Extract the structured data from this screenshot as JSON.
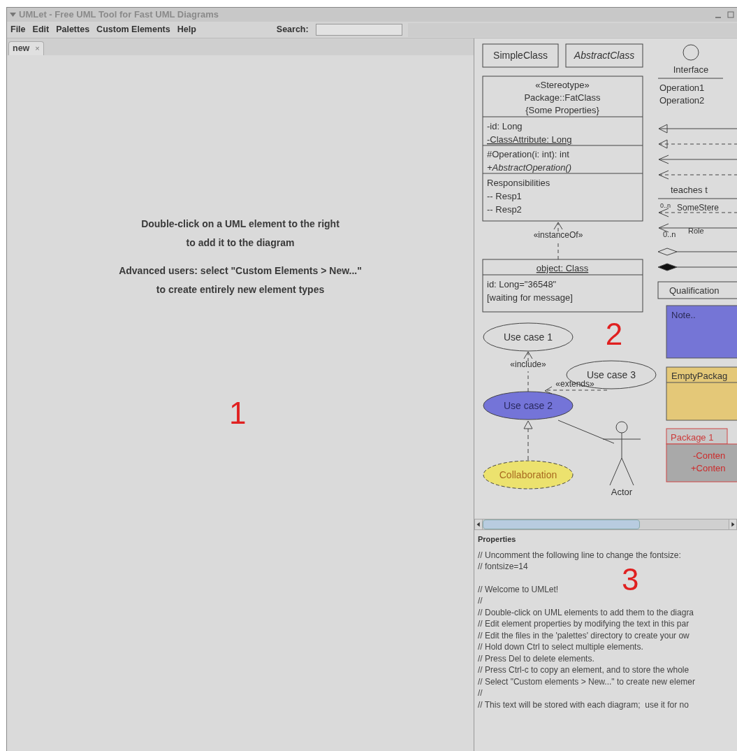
{
  "window": {
    "title": "UMLet - Free UML Tool for Fast UML Diagrams"
  },
  "menu": [
    {
      "label": "File"
    },
    {
      "label": "Edit"
    },
    {
      "label": "Palettes"
    },
    {
      "label": "Custom Elements"
    },
    {
      "label": "Help"
    }
  ],
  "search": {
    "label": "Search:"
  },
  "tabs": [
    {
      "label": "new",
      "selected": true,
      "close": "×"
    }
  ],
  "diagram": {
    "hints": [
      [
        "Double-click on a UML element to the right",
        "to add it to the diagram"
      ],
      [
        "Advanced users: select \"Custom Elements > New...\"",
        "to create entirely new element types"
      ]
    ],
    "annotation": "1"
  },
  "palette": {
    "annotation": "2",
    "simple_class": "SimpleClass",
    "abstract_class": "AbstractClass",
    "interface": {
      "name": "Interface",
      "operations": [
        "Operation1",
        "Operation2"
      ]
    },
    "fat_class": {
      "header": [
        "«Stereotype»",
        "Package::FatClass",
        "{Some Properties}"
      ],
      "attributes": [
        {
          "text": "-id: Long",
          "static": false
        },
        {
          "text": "-ClassAttribute: Long",
          "static": true
        }
      ],
      "operations": [
        {
          "text": "#Operation(i: int): int",
          "abstract": false
        },
        {
          "text": "+AbstractOperation()",
          "abstract": true
        }
      ],
      "responsibilities": [
        "Responsibilities",
        "-- Resp1",
        "-- Resp2"
      ]
    },
    "instance_of": "«instanceOf»",
    "object": {
      "title": "object: Class",
      "lines": [
        "id: Long=\"36548\"",
        "[waiting for message]"
      ]
    },
    "use_cases": [
      {
        "label": "Use case 1",
        "kind": "plain"
      },
      {
        "label": "Use case 3",
        "kind": "plain"
      },
      {
        "label": "Use case 2",
        "kind": "filled"
      },
      {
        "label": "Collaboration",
        "kind": "collaboration"
      }
    ],
    "include": "«include»",
    "extends": "«extends»",
    "actor": "Actor",
    "relations": [
      {
        "kind": "generalization"
      },
      {
        "kind": "realization"
      },
      {
        "kind": "association"
      },
      {
        "kind": "dependency"
      },
      {
        "kind": "labeled",
        "label": "teaches t"
      },
      {
        "kind": "stereotyped",
        "label": "SomeStere",
        "multiplicity": "0..n"
      },
      {
        "kind": "role",
        "label": "Role",
        "multiplicity": "0..n"
      },
      {
        "kind": "aggregation"
      },
      {
        "kind": "composition"
      }
    ],
    "qualification": "Qualification",
    "note": "Note..",
    "empty_package": "EmptyPackag",
    "package": {
      "name": "Package 1",
      "lines": [
        "-Conten",
        "+Conten"
      ]
    }
  },
  "properties": {
    "title": "Properties",
    "annotation": "3",
    "blocks": [
      [
        "// Uncomment the following line to change the fontsize:",
        "// fontsize=14"
      ],
      [
        "// Welcome to UMLet!",
        "//",
        "// Double-click on UML elements to add them to the diagra",
        "// Edit element properties by modifying the text in this par",
        "// Edit the files in the 'palettes' directory to create your ow",
        "// Hold down Ctrl to select multiple elements.",
        "// Press Del to delete elements.",
        "// Press Ctrl-c to copy an element, and to store the whole",
        "// Select \"Custom elements > New...\" to create new elemer",
        "//",
        "// This text will be stored with each diagram;  use it for no"
      ]
    ]
  }
}
